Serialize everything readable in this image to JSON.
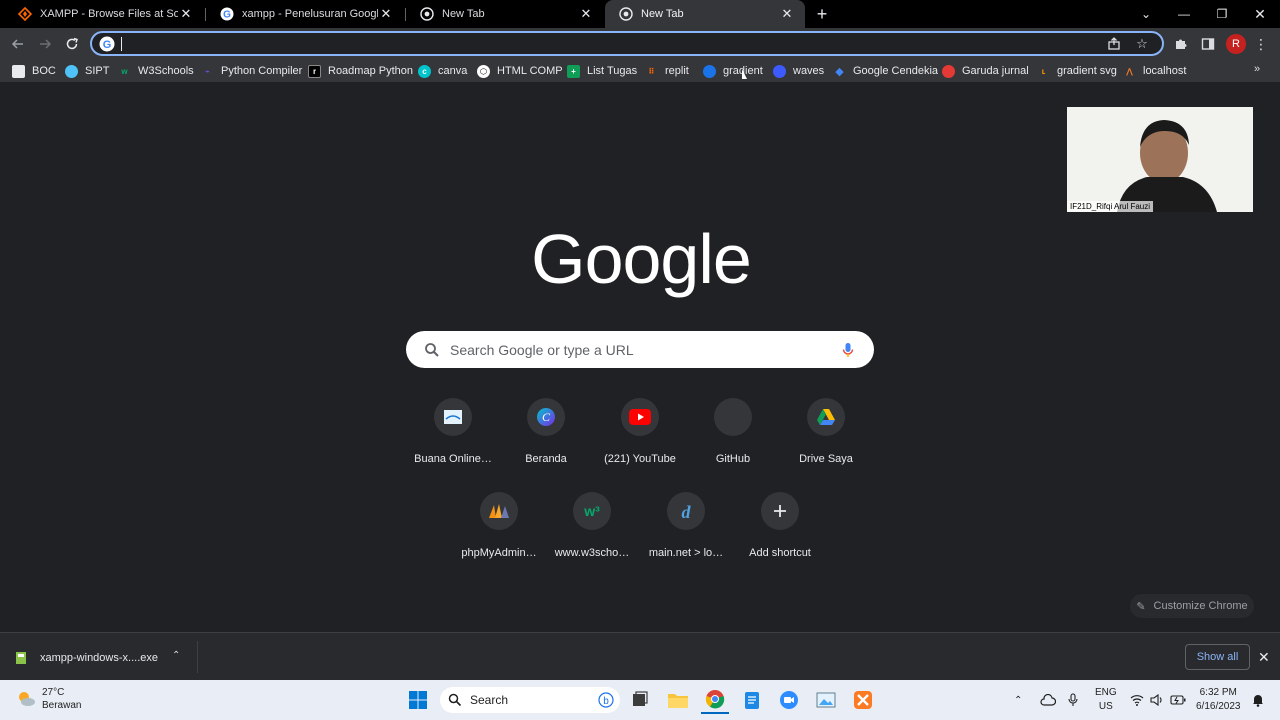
{
  "tabs": [
    {
      "title": "XAMPP - Browse Files at SourceForge.net",
      "active": false
    },
    {
      "title": "xampp - Penelusuran Google",
      "active": false
    },
    {
      "title": "New Tab",
      "active": false
    },
    {
      "title": "New Tab",
      "active": true
    }
  ],
  "omnibox": {
    "value": "",
    "placeholder": ""
  },
  "profile": {
    "initial": "R"
  },
  "bookmarks": [
    {
      "label": "BOC",
      "color": "#e8eaed"
    },
    {
      "label": "SIPT",
      "color": "#4fc3f7"
    },
    {
      "label": "W3Schools",
      "color": "#04aa6d"
    },
    {
      "label": "Python Compiler",
      "color": "#7c4dff"
    },
    {
      "label": "Roadmap Python",
      "color": "#000000"
    },
    {
      "label": "canva",
      "color": "#00c4cc"
    },
    {
      "label": "HTML COMP",
      "color": "#ffffff"
    },
    {
      "label": "List Tugas",
      "color": "#0f9d58"
    },
    {
      "label": "replit",
      "color": "#f26207"
    },
    {
      "label": "gradient",
      "color": "#1a73e8"
    },
    {
      "label": "waves",
      "color": "#3d5afe"
    },
    {
      "label": "Google Cendekia",
      "color": "#4285f4"
    },
    {
      "label": "Garuda jurnal",
      "color": "#e53935"
    },
    {
      "label": "gradient svg",
      "color": "#ff9800"
    },
    {
      "label": "localhost",
      "color": "#fb7a24"
    }
  ],
  "logo_text": "Google",
  "search": {
    "placeholder": "Search Google or type a URL"
  },
  "shortcuts": [
    {
      "label": "Buana Online…",
      "icon": "buana-icon"
    },
    {
      "label": "Beranda",
      "icon": "canva-icon"
    },
    {
      "label": "(221) YouTube",
      "icon": "youtube-icon"
    },
    {
      "label": "GitHub",
      "icon": "github-icon"
    },
    {
      "label": "Drive Saya",
      "icon": "drive-icon"
    },
    {
      "label": "phpMyAdmin…",
      "icon": "phpmyadmin-icon"
    },
    {
      "label": "www.w3scho…",
      "icon": "w3schools-icon"
    },
    {
      "label": "main.net > lo…",
      "icon": "main-net-icon"
    },
    {
      "label": "Add shortcut",
      "icon": "plus-icon"
    }
  ],
  "customize_label": "Customize Chrome",
  "webcam": {
    "name": "IF21D_Rifqi Arul Fauzi"
  },
  "download": {
    "filename": "xampp-windows-x....exe",
    "show_all": "Show all"
  },
  "taskbar": {
    "weather_temp": "27°C",
    "weather_desc": "Berawan",
    "search_label": "Search",
    "lang_line1": "ENG",
    "lang_line2": "US",
    "time": "6:32 PM",
    "date": "6/16/2023"
  }
}
